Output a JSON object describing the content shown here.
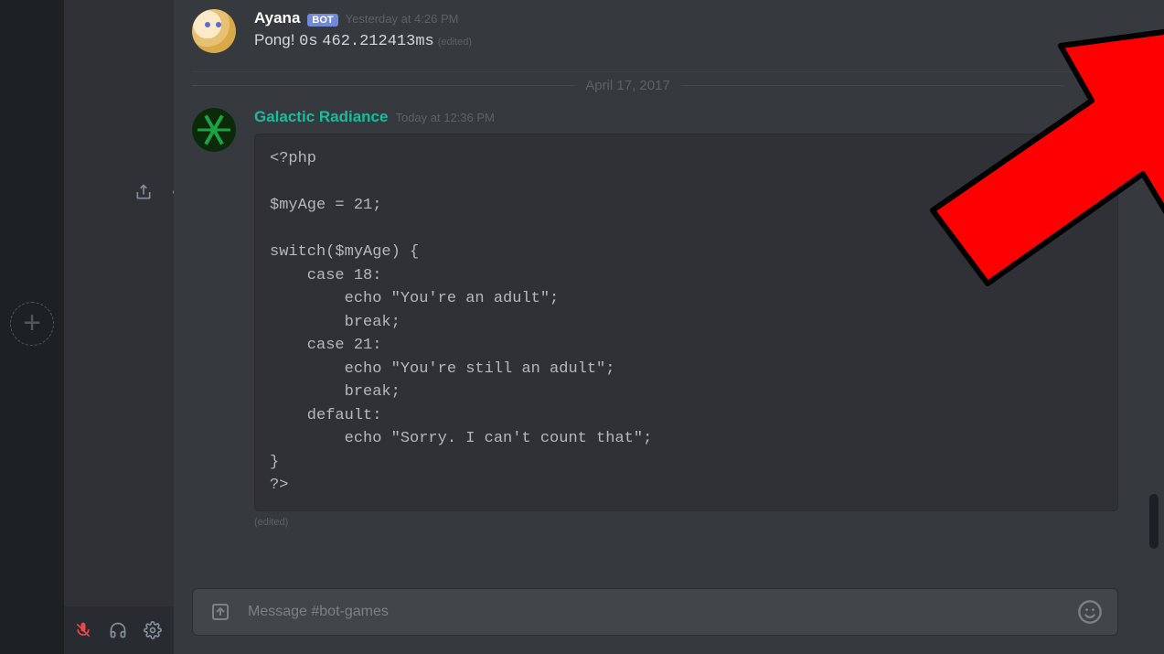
{
  "messages": [
    {
      "author": "Ayana",
      "bot": true,
      "bot_tag": "BOT",
      "timestamp": "Yesterday at 4:26 PM",
      "content_prefix": "Pong! ",
      "content_mono1": "0s",
      "content_mono2": "462.212413ms",
      "edited": "(edited)"
    }
  ],
  "divider": "April 17, 2017",
  "message2": {
    "author": "Galactic Radiance",
    "timestamp": "Today at 12:36 PM",
    "code": "<?php\n\n$myAge = 21;\n\nswitch($myAge) {\n    case 18:\n        echo \"You're an adult\";\n        break;\n    case 21:\n        echo \"You're still an adult\";\n        break;\n    default:\n        echo \"Sorry. I can't count that\";\n}\n?>",
    "edited": "(edited)"
  },
  "input": {
    "placeholder": "Message #bot-games"
  },
  "sidebar": {
    "add_label": "+"
  }
}
